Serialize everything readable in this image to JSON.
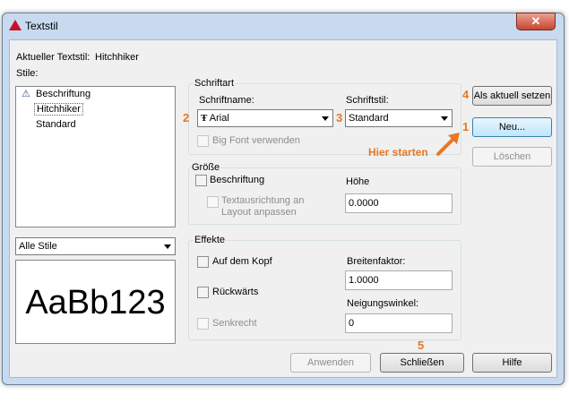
{
  "window": {
    "title": "Textstil",
    "close_glyph": "✕"
  },
  "current_style": {
    "label": "Aktueller Textstil:",
    "value": "Hitchhiker"
  },
  "styles": {
    "label": "Stile:",
    "items": [
      {
        "label": "Beschriftung",
        "icon": "annotative-icon"
      },
      {
        "label": "Hitchhiker",
        "selected": true
      },
      {
        "label": "Standard"
      }
    ],
    "filter": "Alle Stile"
  },
  "preview": {
    "text": "AaBb123"
  },
  "font": {
    "group_title": "Schriftart",
    "name_label": "Schriftname:",
    "name_value": "Arial",
    "name_icon": "truetype-icon",
    "style_label": "Schriftstil:",
    "style_value": "Standard",
    "bigfont_label": "Big Font verwenden"
  },
  "size": {
    "group_title": "Größe",
    "annotative_label": "Beschriftung",
    "match_orientation_label": "Textausrichtung an Layout anpassen",
    "height_label": "Höhe",
    "height_value": "0.0000"
  },
  "effects": {
    "group_title": "Effekte",
    "upside_down_label": "Auf dem Kopf",
    "backwards_label": "Rückwärts",
    "vertical_label": "Senkrecht",
    "width_factor_label": "Breitenfaktor:",
    "width_factor_value": "1.0000",
    "oblique_label": "Neigungswinkel:",
    "oblique_value": "0"
  },
  "buttons": {
    "set_current": "Als aktuell setzen",
    "new": "Neu...",
    "delete": "Löschen",
    "apply": "Anwenden",
    "close": "Schließen",
    "help": "Hilfe"
  },
  "annotations": {
    "n1": "1",
    "n2": "2",
    "n3": "3",
    "n4": "4",
    "n5": "5",
    "hint": "Hier starten",
    "color": "#e87722"
  }
}
